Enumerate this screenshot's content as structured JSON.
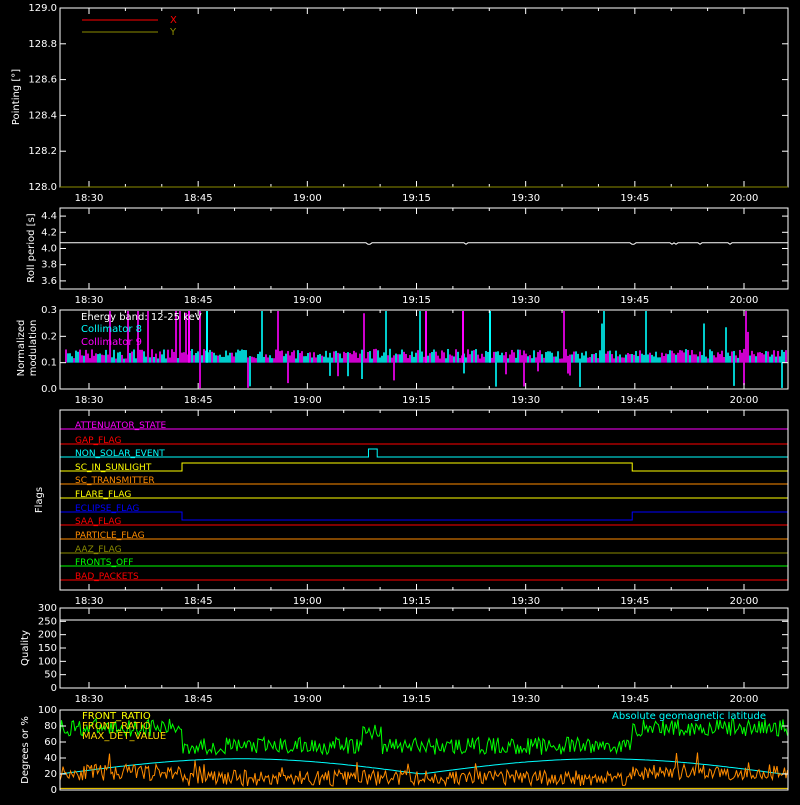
{
  "time_ticks": [
    "18:30",
    "18:45",
    "19:00",
    "19:15",
    "19:30",
    "19:45",
    "20:00"
  ],
  "colors": {
    "background": "#000000",
    "axes": "#ffffff",
    "red": "#ff0000",
    "yellow": "#ffff00",
    "cyan": "#00ffff",
    "magenta": "#ff00ff",
    "blue": "#0000ff",
    "orange": "#ff8c00",
    "green": "#00ff00",
    "olive": "#8b8b00",
    "gold": "#ffd700"
  },
  "chart_data": [
    {
      "type": "line",
      "ylabel": "Pointing [°]",
      "ylim": [
        128.0,
        129.0
      ],
      "yticks": [
        "128.0",
        "128.2",
        "128.4",
        "128.6",
        "128.8",
        "129.0"
      ],
      "legend": [
        "X",
        "Y"
      ],
      "legend_placement": "top-left",
      "series": [
        {
          "name": "X",
          "color": "#ff0000",
          "values": []
        },
        {
          "name": "Y",
          "color": "#8b8b00",
          "values": []
        }
      ]
    },
    {
      "type": "line",
      "ylabel": "Roll period [s]",
      "ylim": [
        3.5,
        4.5
      ],
      "yticks": [
        "3.6",
        "3.8",
        "4.0",
        "4.2",
        "4.4"
      ],
      "series": [
        {
          "color": "#ffffff",
          "baseline": 4.07
        }
      ]
    },
    {
      "type": "bar",
      "ylabel": "Normalized modulation",
      "ylim": [
        0,
        0.3
      ],
      "yticks": [
        "0.0",
        "0.1",
        "0.2",
        "0.3"
      ],
      "annotation": "Energy band: 12-25 keV",
      "legend": [
        "Collimator 8",
        "Collimator 9"
      ],
      "legend_placement": "top-left",
      "series": [
        {
          "name": "Collimator 8",
          "color": "#00ffff",
          "baseline": 0.1
        },
        {
          "name": "Collimator 9",
          "color": "#ff00ff",
          "baseline": 0.1
        }
      ]
    },
    {
      "type": "line",
      "ylabel": "Flags",
      "flags": [
        {
          "name": "ATTENUATOR_STATE",
          "color": "#ff00ff",
          "changes": []
        },
        {
          "name": "GAP_FLAG",
          "color": "#ff0000",
          "changes": []
        },
        {
          "name": "NON_SOLAR_EVENT",
          "color": "#00ffff",
          "changes": [
            [
              19.14,
              19.16
            ]
          ]
        },
        {
          "name": "SC_IN_SUNLIGHT",
          "color": "#ffff00",
          "changes": [
            [
              18.713,
              19.744
            ]
          ]
        },
        {
          "name": "SC_TRANSMITTER",
          "color": "#ff8c00",
          "changes": []
        },
        {
          "name": "FLARE_FLAG",
          "color": "#ffff00",
          "changes": []
        },
        {
          "name": "ECLIPSE_FLAG",
          "color": "#0000ff",
          "changes": [
            [
              18.713,
              19.744
            ]
          ]
        },
        {
          "name": "SAA_FLAG",
          "color": "#ff0000",
          "changes": []
        },
        {
          "name": "PARTICLE_FLAG",
          "color": "#ff8c00",
          "changes": []
        },
        {
          "name": "AAZ_FLAG",
          "color": "#8b8b00",
          "changes": []
        },
        {
          "name": "FRONTS_OFF",
          "color": "#00ff00",
          "changes": []
        },
        {
          "name": "BAD_PACKETS",
          "color": "#ff0000",
          "changes": []
        }
      ]
    },
    {
      "type": "line",
      "ylabel": "Quality",
      "ylim": [
        0,
        300
      ],
      "yticks": [
        "0",
        "50",
        "100",
        "150",
        "200",
        "250",
        "300"
      ],
      "series": [
        {
          "color": "#ffffff",
          "values": []
        }
      ]
    },
    {
      "type": "line",
      "ylabel": "Degrees or %",
      "ylim": [
        0,
        100
      ],
      "yticks": [
        "0",
        "20",
        "40",
        "60",
        "80",
        "100"
      ],
      "legend": [
        "FRONT_RATIO",
        "FRONT_RATIO",
        "MAX_DET_VALUE"
      ],
      "annotation": "Absolute geomagnetic latitude",
      "series": [
        {
          "name": "FRONT_RATIO",
          "color": "#00ff00",
          "levels": {
            "day": 55,
            "night": 78
          }
        },
        {
          "name": "FRONT_RATIO",
          "color": "#ff8c00",
          "levels": {
            "day": 15,
            "night": 22
          }
        },
        {
          "name": "MAX_DET_VALUE",
          "color": "#ffd700"
        },
        {
          "name": "Absolute geomagnetic latitude",
          "color": "#00ffff",
          "range": [
            0,
            40
          ]
        }
      ]
    }
  ]
}
